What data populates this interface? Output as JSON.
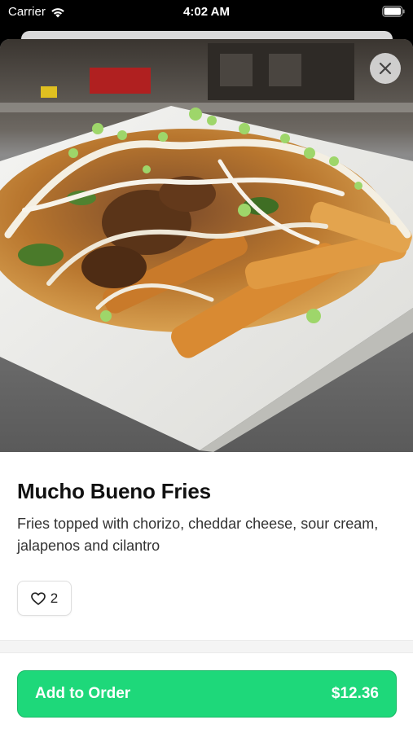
{
  "status_bar": {
    "carrier": "Carrier",
    "time": "4:02 AM"
  },
  "item": {
    "title": "Mucho Bueno Fries",
    "description": "Fries topped with chorizo, cheddar cheese, sour cream, jalapenos and cilantro",
    "like_count": "2"
  },
  "order_button": {
    "label": "Add to Order",
    "price": "$12.36"
  },
  "colors": {
    "accent": "#1ed87a",
    "accent_border": "#18b865"
  },
  "icons": {
    "close": "close-icon",
    "like": "heart-icon",
    "wifi": "wifi-icon",
    "battery": "battery-icon"
  }
}
